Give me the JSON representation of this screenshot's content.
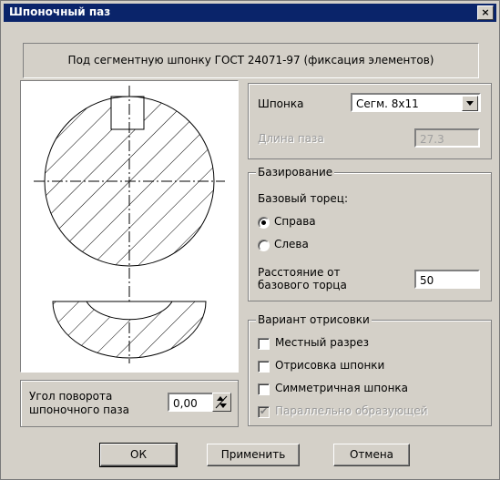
{
  "window": {
    "title": "Шпоночный паз",
    "close_glyph": "×"
  },
  "banner": {
    "text": "Под сегментную шпонку ГОСТ 24071-97 (фиксация элементов)"
  },
  "key": {
    "label": "Шпонка",
    "selected": "Сегм. 8х11",
    "length_label": "Длина паза",
    "length_value": "27.3"
  },
  "basing": {
    "title": "Базирование",
    "face_label": "Базовый торец:",
    "options": [
      "Справа",
      "Слева"
    ],
    "selected_option": "Справа",
    "distance_label_line1": "Расстояние от",
    "distance_label_line2": "базового торца",
    "distance_value": "50"
  },
  "drawing": {
    "title": "Вариант отрисовки",
    "checks": [
      {
        "label": "Местный разрез",
        "checked": false,
        "enabled": true
      },
      {
        "label": "Отрисовка шпонки",
        "checked": false,
        "enabled": true
      },
      {
        "label": "Симметричная шпонка",
        "checked": false,
        "enabled": true
      },
      {
        "label": "Параллельно образующей",
        "checked": true,
        "enabled": false
      }
    ]
  },
  "angle": {
    "label_line1": "Угол поворота",
    "label_line2": "шпоночного паза",
    "value": "0,00"
  },
  "buttons": {
    "ok": "ОК",
    "apply": "Применить",
    "cancel": "Отмена"
  }
}
